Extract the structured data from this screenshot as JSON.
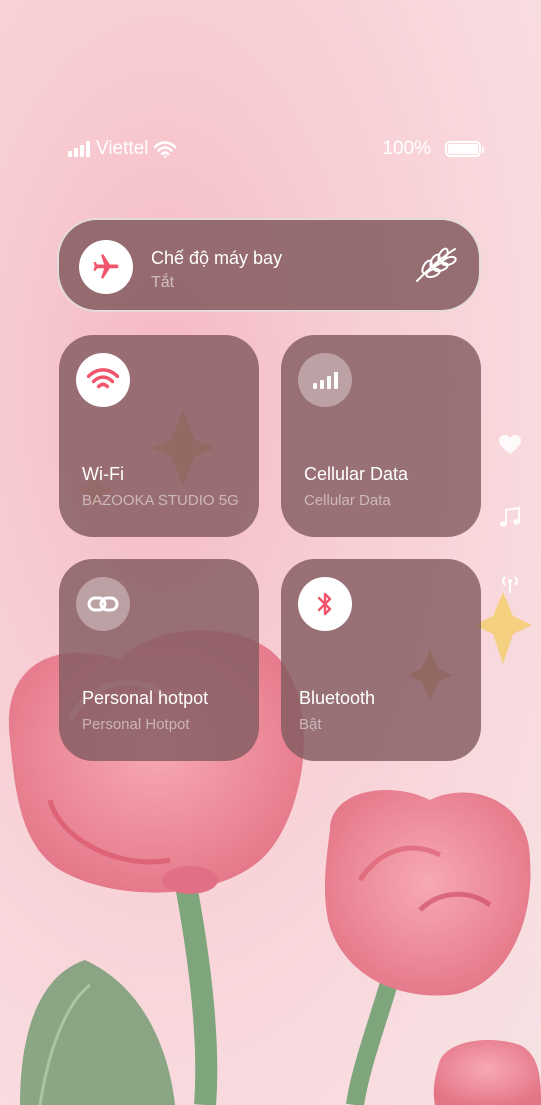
{
  "status_bar": {
    "carrier": "Viettel",
    "battery_percent": "100%",
    "signal_icon": "signal-bars-icon",
    "wifi_icon": "wifi-icon",
    "battery_icon": "battery-icon"
  },
  "airplane_mode": {
    "title": "Chế độ máy bay",
    "status": "Tắt",
    "icon": "airplane-icon",
    "decoration_icon": "leaf-sprig-icon"
  },
  "tiles": [
    {
      "title": "Wi-Fi",
      "subtitle": "BAZOOKA STUDIO 5G",
      "icon": "wifi-icon",
      "active": true
    },
    {
      "title": "Cellular Data",
      "subtitle": "Cellular Data",
      "icon": "cellular-bars-icon",
      "active": false
    },
    {
      "title": "Personal hotpot",
      "subtitle": "Personal Hotpot",
      "icon": "link-icon",
      "active": false
    },
    {
      "title": "Bluetooth",
      "subtitle": "Bật",
      "icon": "bluetooth-icon",
      "active": true
    }
  ],
  "side_icons": [
    "heart-icon",
    "music-note-icon",
    "broadcast-icon"
  ],
  "colors": {
    "accent": "#f0556c",
    "tile_background": "#825c60",
    "page_background": "#f7d3d8"
  }
}
